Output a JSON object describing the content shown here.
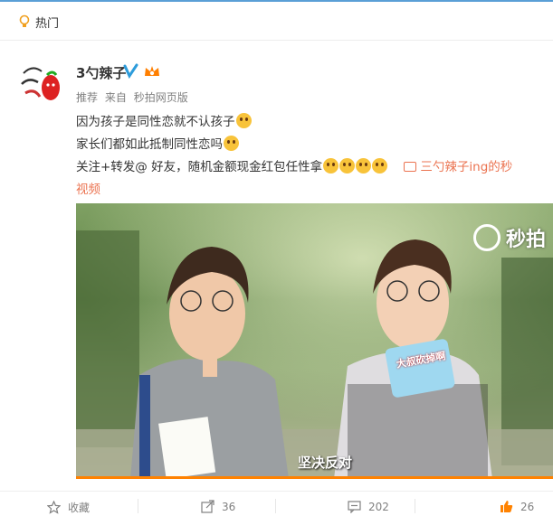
{
  "colors": {
    "accent": "#eb7350",
    "like": "#ff8200",
    "topbar": "#5a9fd6"
  },
  "header": {
    "section_label": "热门",
    "icon": "lightbulb-icon"
  },
  "post": {
    "username": "3勺辣子",
    "verified_icon": "verified-v-icon",
    "member_icon": "member-crown-icon",
    "meta": {
      "recommend": "推荐",
      "from": "来自",
      "source": "秒拍网页版"
    },
    "lines": [
      "因为孩子是同性恋就不认孩子",
      "家长们都如此抵制同性恋吗",
      "关注+转发@ 好友，随机金额现金红包任性拿"
    ],
    "video_link_text": "三勺辣子ing的秒",
    "video_link_text_2": "视频",
    "video": {
      "watermark": "秒拍",
      "caption": "坚决反对",
      "sign_text": "大叔砍掉啊"
    }
  },
  "actions": {
    "favorite_label": "收藏",
    "repost_count": "36",
    "comment_count": "202",
    "like_count": "26"
  }
}
